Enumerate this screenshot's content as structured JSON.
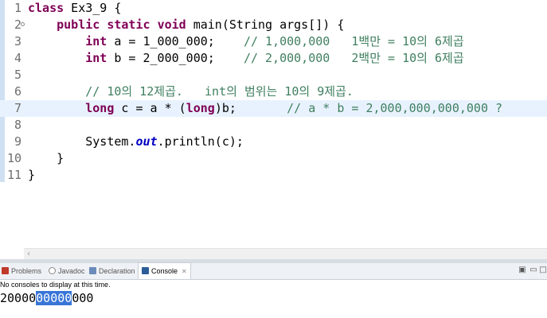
{
  "editor": {
    "lines": [
      {
        "n": "1",
        "parts": [
          {
            "t": "class",
            "c": "kw"
          },
          {
            "t": " Ex3_9 {"
          }
        ]
      },
      {
        "n": "2",
        "fold": true,
        "parts": [
          {
            "t": "    "
          },
          {
            "t": "public",
            "c": "kw"
          },
          {
            "t": " "
          },
          {
            "t": "static",
            "c": "kw"
          },
          {
            "t": " "
          },
          {
            "t": "void",
            "c": "kw"
          },
          {
            "t": " main(String args[]) {"
          }
        ]
      },
      {
        "n": "3",
        "parts": [
          {
            "t": "        "
          },
          {
            "t": "int",
            "c": "kw"
          },
          {
            "t": " a = 1_000_000;    "
          },
          {
            "t": "// 1,000,000   1백만 = 10의 6제곱",
            "c": "cm"
          }
        ]
      },
      {
        "n": "4",
        "parts": [
          {
            "t": "        "
          },
          {
            "t": "int",
            "c": "kw"
          },
          {
            "t": " b = 2_000_000;    "
          },
          {
            "t": "// 2,000,000   2백만 = 10의 6제곱",
            "c": "cm"
          }
        ]
      },
      {
        "n": "5",
        "parts": []
      },
      {
        "n": "6",
        "parts": [
          {
            "t": "        "
          },
          {
            "t": "// 10의 12제곱.   int의 범위는 10의 9제곱.",
            "c": "cm"
          }
        ]
      },
      {
        "n": "7",
        "current": true,
        "parts": [
          {
            "t": "        "
          },
          {
            "t": "long",
            "c": "kw"
          },
          {
            "t": " c = a * ("
          },
          {
            "t": "long",
            "c": "kw"
          },
          {
            "t": ")b;       "
          },
          {
            "t": "// a * b = 2,000,000,000,000 ?",
            "c": "cm"
          }
        ]
      },
      {
        "n": "8",
        "parts": []
      },
      {
        "n": "9",
        "parts": [
          {
            "t": "        System."
          },
          {
            "t": "out",
            "c": "fld"
          },
          {
            "t": ".println(c);"
          }
        ]
      },
      {
        "n": "10",
        "parts": [
          {
            "t": "    }"
          }
        ]
      },
      {
        "n": "11",
        "parts": [
          {
            "t": "}"
          }
        ]
      }
    ]
  },
  "scrollbar": {
    "left_arrow": "‹"
  },
  "tabs": [
    {
      "name": "problems",
      "label": "Problems",
      "icon_color": "#c0392b"
    },
    {
      "name": "javadoc",
      "label": "Javadoc",
      "icon_color": "#888888"
    },
    {
      "name": "declaration",
      "label": "Declaration",
      "icon_color": "#6b8cba"
    },
    {
      "name": "console",
      "label": "Console",
      "icon_color": "#2c5d99",
      "close": "✕"
    }
  ],
  "console": {
    "message": "No consoles to display at this time.",
    "output_before": "20000",
    "output_selected": "00000",
    "output_after": "000"
  }
}
